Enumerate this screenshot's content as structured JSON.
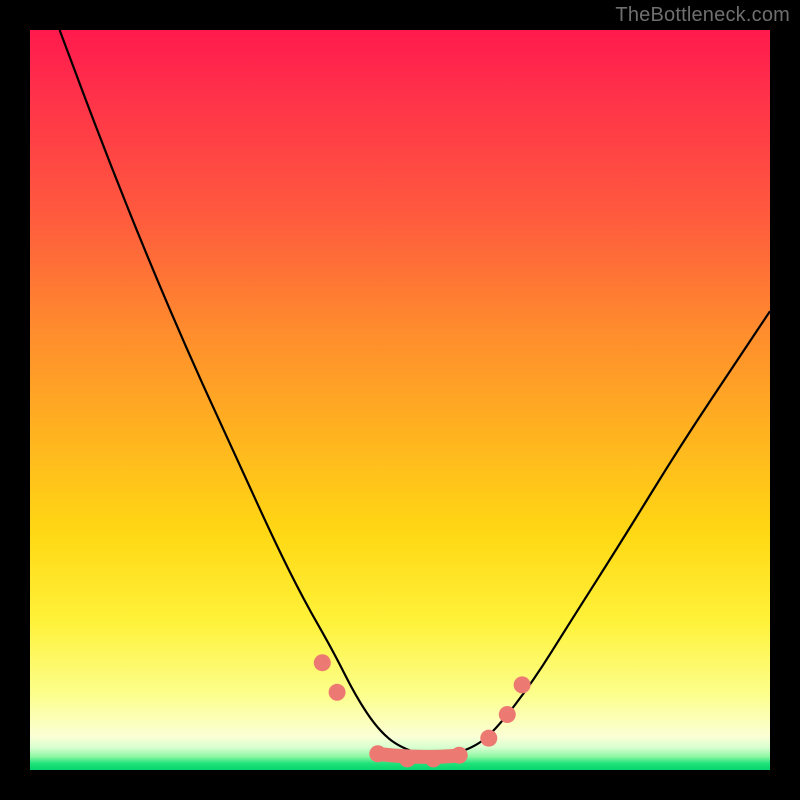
{
  "watermark": "TheBottleneck.com",
  "chart_data": {
    "type": "line",
    "title": "",
    "xlabel": "",
    "ylabel": "",
    "xlim": [
      0,
      1
    ],
    "ylim": [
      0,
      1
    ],
    "series": [
      {
        "name": "curve",
        "x": [
          0.04,
          0.1,
          0.16,
          0.22,
          0.28,
          0.33,
          0.37,
          0.41,
          0.44,
          0.47,
          0.5,
          0.55,
          0.6,
          0.63,
          0.68,
          0.73,
          0.8,
          0.88,
          0.96,
          1.0
        ],
        "y": [
          1.0,
          0.84,
          0.69,
          0.55,
          0.42,
          0.31,
          0.23,
          0.16,
          0.1,
          0.055,
          0.03,
          0.015,
          0.03,
          0.055,
          0.12,
          0.2,
          0.31,
          0.44,
          0.56,
          0.62
        ]
      },
      {
        "name": "dots",
        "x": [
          0.395,
          0.415,
          0.47,
          0.51,
          0.545,
          0.58,
          0.62,
          0.645,
          0.665
        ],
        "y": [
          0.145,
          0.105,
          0.022,
          0.015,
          0.015,
          0.02,
          0.043,
          0.075,
          0.115
        ]
      }
    ],
    "colors": {
      "curve": "#000000",
      "dots": "#ec7a73"
    }
  }
}
